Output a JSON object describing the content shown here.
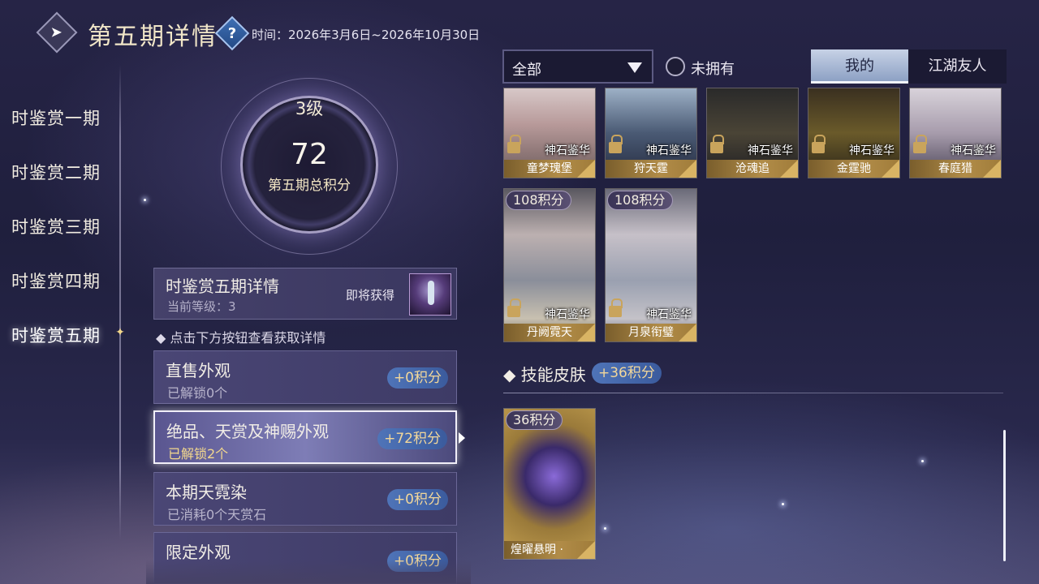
{
  "header": {
    "title": "第五期详情",
    "time": "时间：2026年3月6日~2026年10月30日"
  },
  "periods": [
    {
      "label": "时鉴赏一期"
    },
    {
      "label": "时鉴赏二期"
    },
    {
      "label": "时鉴赏三期"
    },
    {
      "label": "时鉴赏四期"
    },
    {
      "label": "时鉴赏五期",
      "active": true
    }
  ],
  "summary": {
    "level": "3级",
    "points": "72",
    "points_label": "第五期总积分"
  },
  "detail": {
    "title": "时鉴赏五期详情",
    "current_level": "当前等级：3",
    "soon_label": "即将获得"
  },
  "hint": "◆ 点击下方按钮查看获取详情",
  "categories": [
    {
      "name": "直售外观",
      "sub": "已解锁0个",
      "points": "+0积分"
    },
    {
      "name": "绝品、天赏及神赐外观",
      "sub": "已解锁2个",
      "points": "+72积分",
      "selected": true
    },
    {
      "name": "本期天霓染",
      "sub": "已消耗0个天赏石",
      "points": "+0积分"
    },
    {
      "name": "限定外观",
      "sub": "",
      "points": "+0积分"
    }
  ],
  "filter": {
    "selected": "全部",
    "not_owned_label": "未拥有"
  },
  "view_tabs": {
    "mine": "我的",
    "friends": "江湖友人"
  },
  "items": [
    {
      "name": "童梦瑰堡",
      "type": "神石鉴华"
    },
    {
      "name": "狩天霆",
      "type": "神石鉴华"
    },
    {
      "name": "沧魂追",
      "type": "神石鉴华"
    },
    {
      "name": "金霆驰",
      "type": "神石鉴华"
    },
    {
      "name": "春庭猎",
      "type": "神石鉴华"
    },
    {
      "name": "丹阙霓天",
      "type": "神石鉴华",
      "points": "108积分"
    },
    {
      "name": "月泉衔璧",
      "type": "神石鉴华",
      "points": "108积分"
    }
  ],
  "skill_section": {
    "title": "◆ 技能皮肤",
    "points": "+36积分",
    "items": [
      {
        "name": "煌曜悬明 ·",
        "points": "36积分"
      }
    ]
  },
  "colors": {
    "accent_gold": "#f2d79a",
    "badge_blue": "#4f74b8",
    "name_bar_gold": "#b18c48"
  }
}
